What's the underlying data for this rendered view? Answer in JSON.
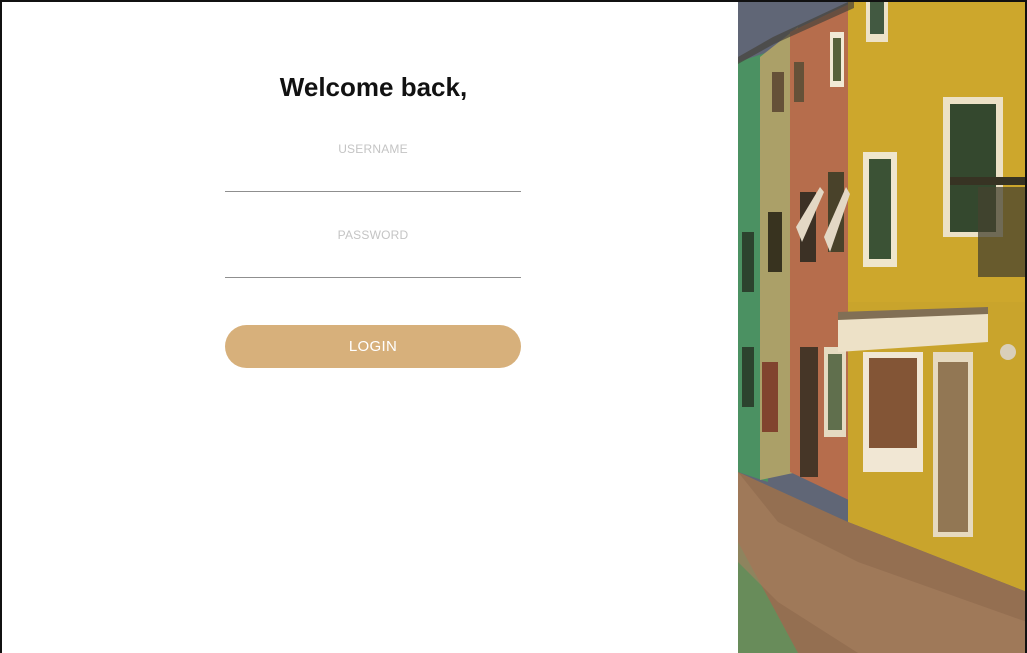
{
  "login_form": {
    "title": "Welcome back,",
    "username": {
      "label": "USERNAME",
      "value": "",
      "placeholder": ""
    },
    "password": {
      "label": "PASSWORD",
      "value": "",
      "placeholder": ""
    },
    "login_label": "LOGIN"
  },
  "colors": {
    "accent": "#d7b07b",
    "label_gray": "#c4c4c4",
    "underline_gray": "#8f8f8f"
  },
  "side_image": {
    "subject": "colorful-street-houses-photo"
  }
}
